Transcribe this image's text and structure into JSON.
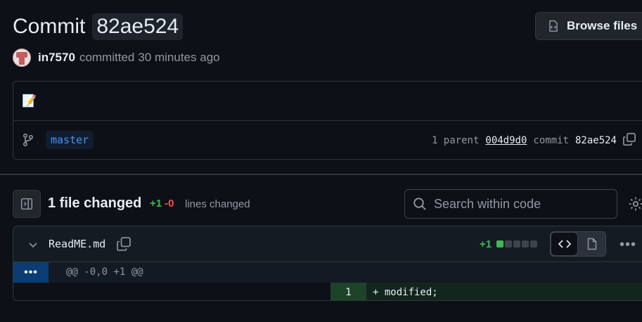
{
  "header": {
    "title_label": "Commit",
    "commit_hash": "82ae524",
    "browse_files_label": "Browse files"
  },
  "author": {
    "username": "in7570",
    "action": "committed",
    "time": "30 minutes ago"
  },
  "commit": {
    "message_emoji": "📝",
    "branch": "master",
    "parent_label": "1 parent",
    "parent_sha": "004d9d0",
    "commit_label": "commit",
    "commit_sha": "82ae524"
  },
  "files_summary": {
    "files_changed": "1 file changed",
    "additions": "+1",
    "deletions": "-0",
    "lines_changed_label": "lines changed",
    "search_placeholder": "Search within code"
  },
  "file": {
    "name": "ReadME.md",
    "additions": "+1",
    "diffstat_blocks": [
      "added",
      "neutral",
      "neutral",
      "neutral",
      "neutral"
    ],
    "hunk_expand": "•••",
    "hunk_header": "@@ -0,0 +1 @@",
    "lines": [
      {
        "new_line_number": "1",
        "content": "+ modified;"
      }
    ]
  },
  "colors": {
    "background": "#0d1117",
    "accent_blue": "#4493f8",
    "addition_green": "#3fb950",
    "deletion_red": "#f85149"
  }
}
